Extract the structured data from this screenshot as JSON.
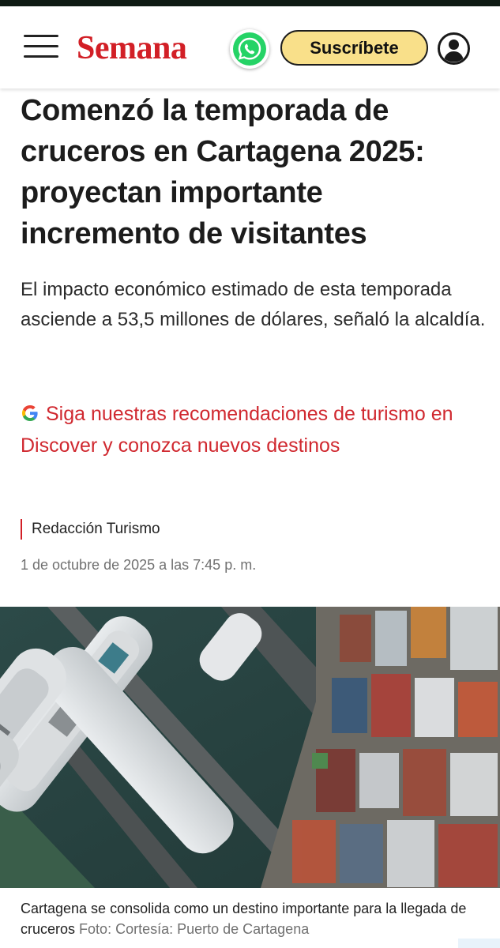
{
  "header": {
    "logo": "Semana",
    "subscribe_label": "Suscríbete",
    "icons": {
      "menu": "menu-icon",
      "whatsapp": "whatsapp-icon",
      "account": "user-circle-icon"
    },
    "colors": {
      "brand": "#d21f26",
      "subscribe_bg": "#f9e08a",
      "whatsapp": "#25d366"
    }
  },
  "article": {
    "headline": "Comenzó la temporada de cruceros en Cartagena 2025: proyectan importante incremento de visitantes",
    "lede": "El impacto económico estimado de esta temporada asciende a 53,5 millones de dólares, señaló la alcaldía.",
    "discover_link": "Siga nuestras recomendaciones de turismo en Discover y conozca nuevos destinos",
    "discover_icon": "google-g-icon",
    "author": "Redacción Turismo",
    "date": "1 de octubre de 2025 a las 7:45 p. m.",
    "photo": {
      "description_icon": "aerial-port-photo"
    },
    "caption": "Cartagena se consolida como un destino importante para la llegada de cruceros",
    "caption_credit": "Foto: Cortesía: Puerto de Cartagena"
  }
}
